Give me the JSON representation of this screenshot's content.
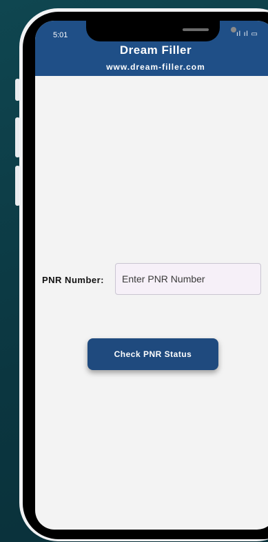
{
  "status_bar": {
    "time": "5:01",
    "icons": "ıl ıl ▭"
  },
  "header": {
    "title": "Dream Filler",
    "subtitle": "www.dream-filler.com"
  },
  "form": {
    "pnr_label": "PNR Number:",
    "pnr_placeholder": "Enter PNR Number",
    "pnr_value": "",
    "submit_label": "Check PNR Status"
  },
  "colors": {
    "header_bg": "#1f4f87",
    "button_bg": "#1f4a7e",
    "background": "#0d3a44",
    "screen_bg": "#f3f3f3"
  }
}
